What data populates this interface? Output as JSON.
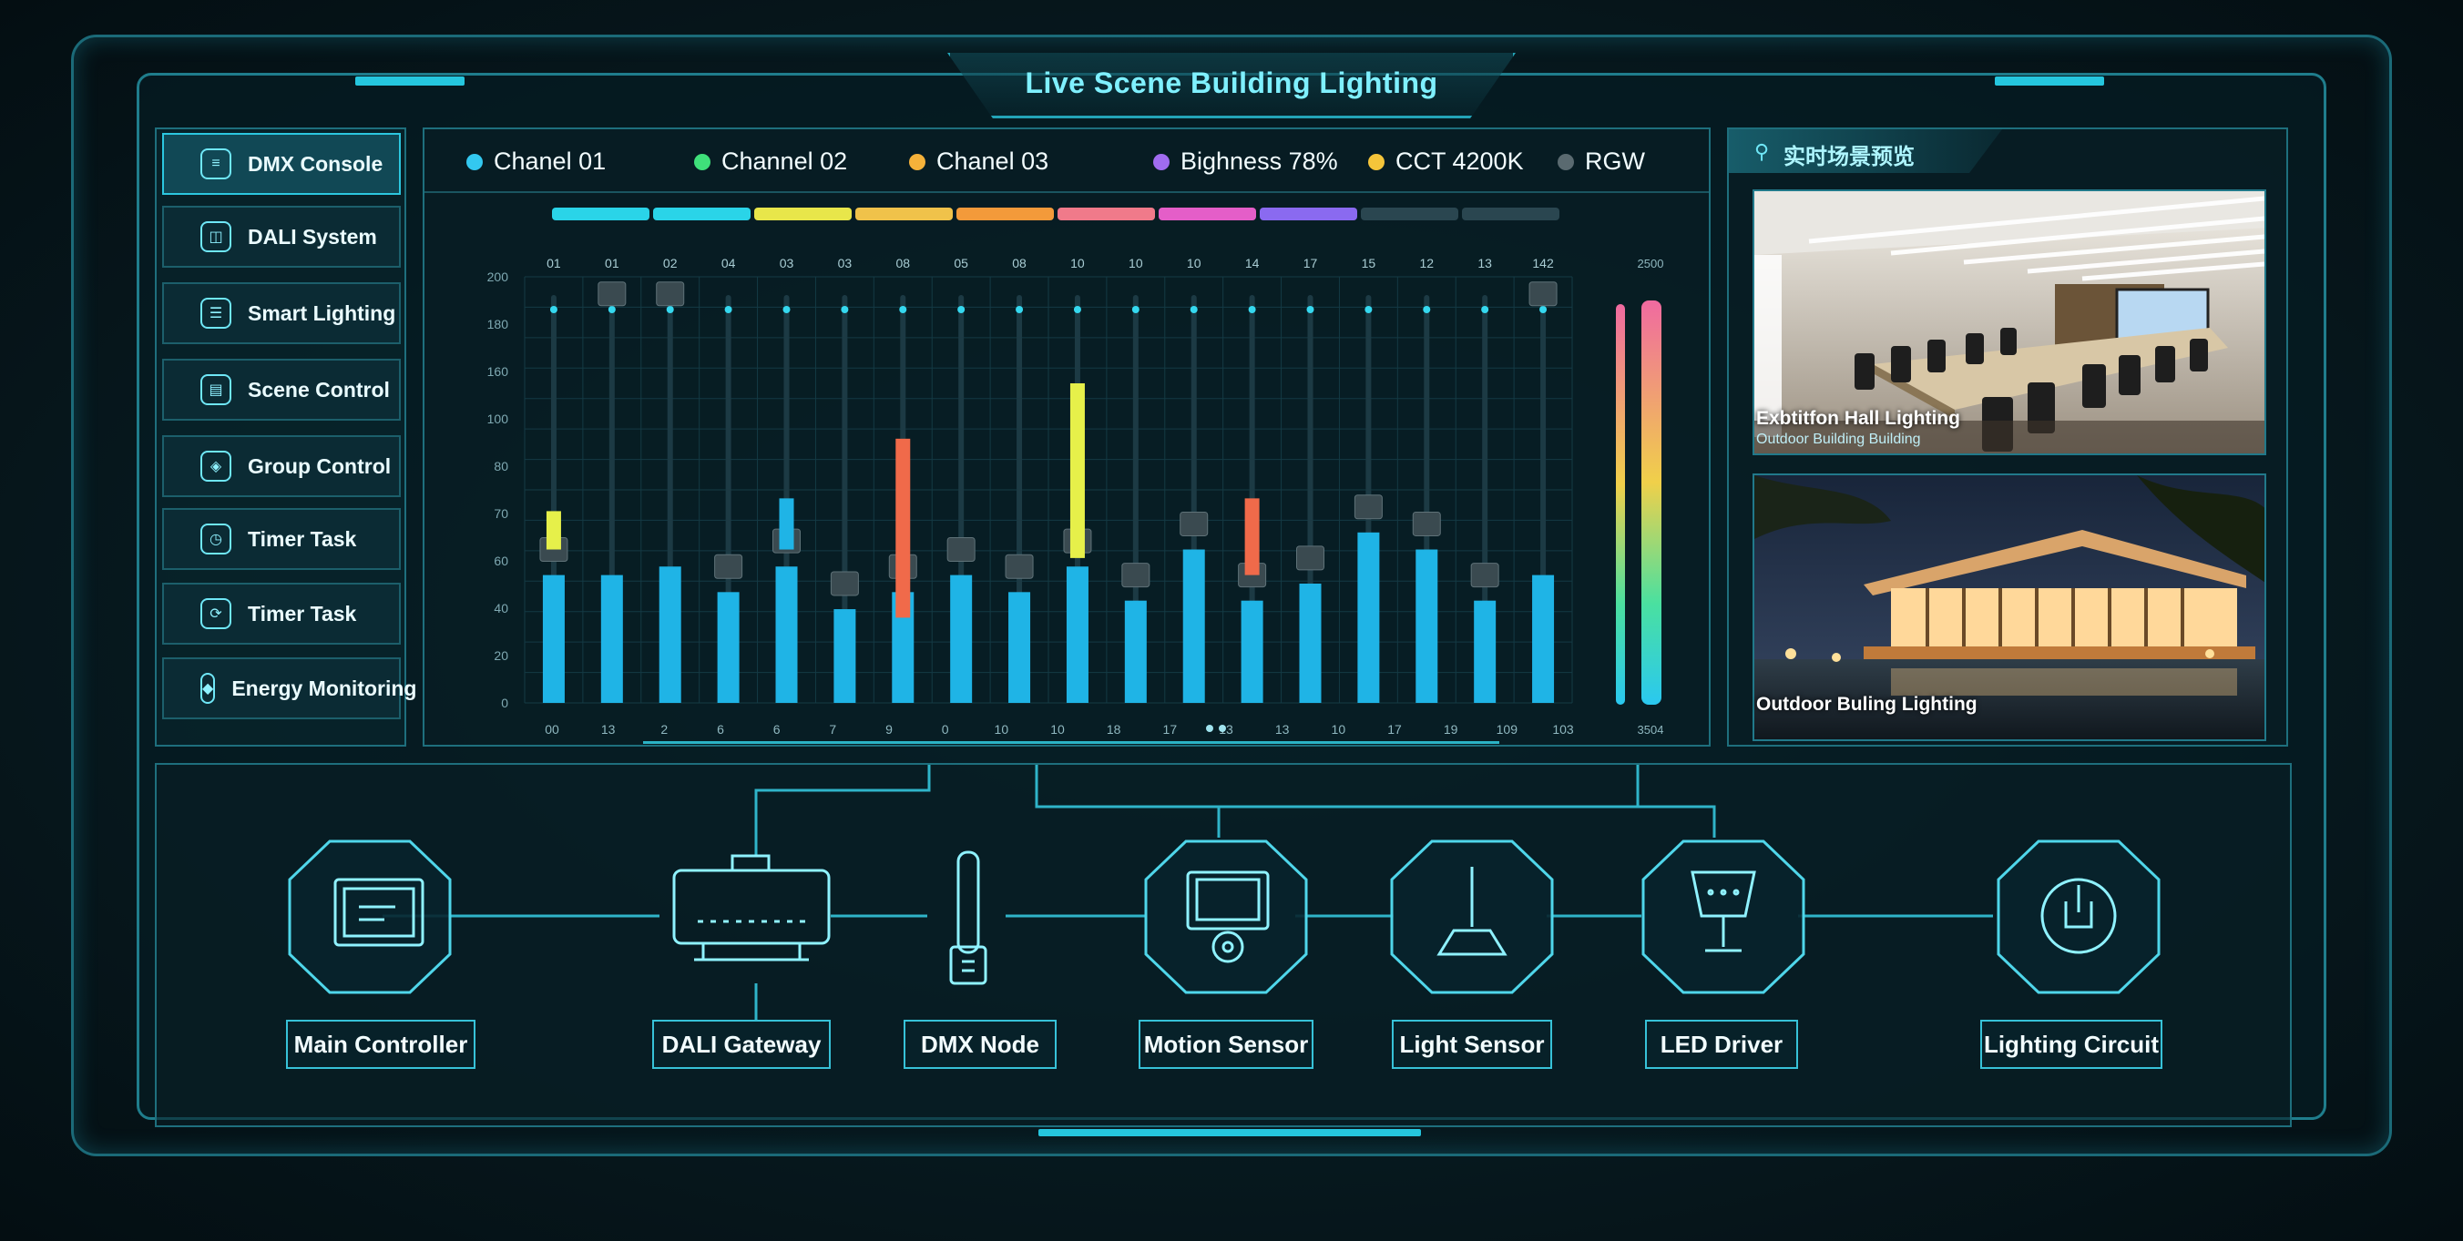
{
  "app": {
    "title": "Live Scene Building Lighting"
  },
  "sidebar": {
    "items": [
      {
        "label": "DMX Console",
        "icon": "sliders-icon",
        "active": true
      },
      {
        "label": "DALI System",
        "icon": "dali-icon"
      },
      {
        "label": "Smart Lighting",
        "icon": "smart-bulb-icon"
      },
      {
        "label": "Scene Control",
        "icon": "scene-icon"
      },
      {
        "label": "Group Control",
        "icon": "group-icon"
      },
      {
        "label": "Timer Task",
        "icon": "timer-icon"
      },
      {
        "label": "Timer Task",
        "icon": "clock-icon"
      },
      {
        "label": "Energy Monitoring",
        "icon": "energy-icon"
      }
    ]
  },
  "header": {
    "channels": [
      {
        "label": "Chanel 01",
        "color": "#33c8f0"
      },
      {
        "label": "Channel 02",
        "color": "#3fe07a"
      },
      {
        "label": "Chanel 03",
        "color": "#f5b23a"
      }
    ],
    "brightness": {
      "label": "Bighness 78%",
      "color": "#a06cf0"
    },
    "cct": {
      "label": "CCT 4200K",
      "color": "#f5c53a"
    },
    "mode": {
      "label": "RGW",
      "color": "#5a6a70"
    }
  },
  "chart_data": {
    "type": "bar",
    "y_tick_labels": [
      "0",
      "20",
      "40",
      "60",
      "70",
      "80",
      "100",
      "160",
      "180",
      "200"
    ],
    "top_channel_labels": [
      "01",
      "01",
      "02",
      "04",
      "03",
      "03",
      "08",
      "05",
      "08",
      "10",
      "10",
      "10",
      "14",
      "17",
      "15",
      "12",
      "13",
      "142"
    ],
    "x_tick_labels": [
      "00",
      "13",
      "2",
      "6",
      "6",
      "7",
      "9",
      "0",
      "10",
      "10",
      "18",
      "17",
      "13",
      "13",
      "10",
      "17",
      "19",
      "109",
      "103"
    ],
    "right_scale_labels": [
      "2500",
      "3504"
    ],
    "colors": {
      "accent": "#2cc7df",
      "bar": "#1fb4e6",
      "yellow": "#e6f04a",
      "red": "#f06a4a"
    },
    "values": [
      30,
      30,
      32,
      26,
      32,
      22,
      26,
      30,
      26,
      32,
      24,
      36,
      24,
      28,
      40,
      36,
      24,
      30
    ],
    "fader_levels": [
      22,
      96,
      96,
      22,
      22,
      22,
      22,
      22,
      22,
      22,
      22,
      22,
      22,
      22,
      22,
      22,
      22,
      96
    ],
    "highlights": [
      {
        "bar": 0,
        "color": "yellow",
        "from": 36,
        "to": 45
      },
      {
        "bar": 4,
        "color": "bar",
        "from": 36,
        "to": 48
      },
      {
        "bar": 6,
        "color": "red",
        "from": 20,
        "to": 62
      },
      {
        "bar": 9,
        "color": "yellow",
        "from": 34,
        "to": 75
      },
      {
        "bar": 12,
        "color": "red",
        "from": 30,
        "to": 48
      }
    ],
    "ylim": [
      0,
      100
    ]
  },
  "preview": {
    "title": "实时场景预览",
    "images": [
      {
        "caption": "Exbtitfon Hall Lighting",
        "sub": "Outdoor Building Building",
        "name": "exhibition-hall-image"
      },
      {
        "caption": "Outdoor Buling Lighting",
        "sub": "",
        "name": "outdoor-building-image"
      }
    ]
  },
  "network": {
    "nodes": [
      {
        "label": "Main Controller",
        "icon": "controller-icon"
      },
      {
        "label": "DALI Gateway",
        "icon": "gateway-icon"
      },
      {
        "label": "DMX Node",
        "icon": "dmx-node-icon"
      },
      {
        "label": "Motion Sensor",
        "icon": "motion-sensor-icon"
      },
      {
        "label": "Light Sensor",
        "icon": "light-sensor-icon"
      },
      {
        "label": "LED Driver",
        "icon": "led-driver-icon"
      },
      {
        "label": "Lighting Circuit",
        "icon": "lighting-circuit-icon"
      }
    ]
  }
}
